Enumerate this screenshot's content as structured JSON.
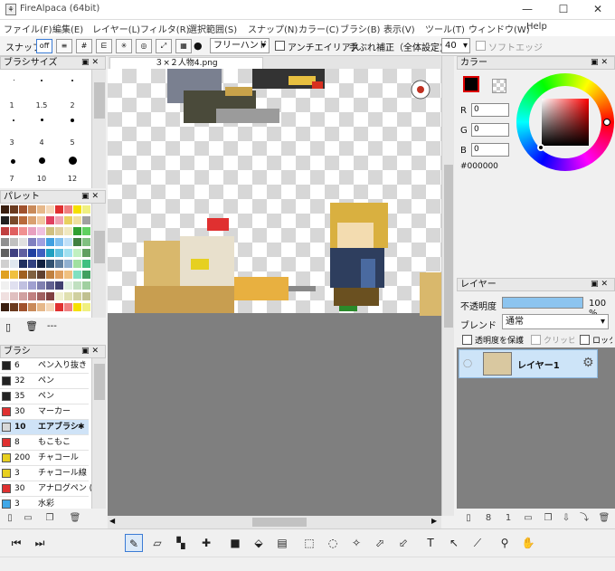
{
  "window": {
    "title": "FireAlpaca (64bit)",
    "min": "—",
    "max": "☐",
    "close": "✕"
  },
  "menu": [
    "ファイル(F)",
    "編集(E)",
    "レイヤー(L)",
    "フィルタ(R)",
    "選択範囲(S)",
    "スナップ(N)",
    "カラー(C)",
    "ブラシ(B)",
    "表示(V)",
    "ツール(T)",
    "ウィンドウ(W)",
    "Help"
  ],
  "toolbar": {
    "snap_label": "スナップ",
    "snap_off": "off",
    "mode_value": "フリーハンド",
    "antialias_label": "アンチエイリアス",
    "stabilizer_label": "手ぶれ補正（全体設定)",
    "stabilizer_value": "40",
    "soft_edge_label": "ソフトエッジ"
  },
  "brush_size_panel": {
    "title": "ブラシサイズ",
    "sizes": [
      "1",
      "1.5",
      "2",
      "3",
      "4",
      "5",
      "7",
      "10",
      "12"
    ]
  },
  "palette_panel": {
    "title": "パレット",
    "dashes": "---"
  },
  "brush_panel": {
    "title": "ブラシ",
    "items": [
      {
        "size": "6",
        "name": "ペン入り抜き",
        "color": "#222222"
      },
      {
        "size": "32",
        "name": "ペン",
        "color": "#222222"
      },
      {
        "size": "35",
        "name": "ペン",
        "color": "#222222"
      },
      {
        "size": "30",
        "name": "マーカー",
        "color": "#e03030"
      },
      {
        "size": "10",
        "name": "エアブラシ",
        "color": "#d8d8d8"
      },
      {
        "size": "8",
        "name": "もこもこ",
        "color": "#e03030"
      },
      {
        "size": "200",
        "name": "チャコール",
        "color": "#e8d020"
      },
      {
        "size": "3",
        "name": "チャコール線",
        "color": "#e8d020"
      },
      {
        "size": "30",
        "name": "アナログペン (",
        "color": "#e03030"
      },
      {
        "size": "3",
        "name": "水彩",
        "color": "#40a8e8"
      }
    ]
  },
  "canvas": {
    "tab_title": "３×２人物4.png"
  },
  "color_panel": {
    "title": "カラー",
    "r_label": "R",
    "g_label": "G",
    "b_label": "B",
    "r": "0",
    "g": "0",
    "b": "0",
    "hex": "#000000",
    "primary": "#000000"
  },
  "layer_panel": {
    "title": "レイヤー",
    "opacity_label": "不透明度",
    "opacity_value": "100 %",
    "opacity": 1.0,
    "blend_label": "ブレンド",
    "blend_value": "通常",
    "protect_alpha": "透明度を保護",
    "clipping": "クリッピング",
    "lock": "ロック",
    "layer_name": "レイヤー1"
  }
}
